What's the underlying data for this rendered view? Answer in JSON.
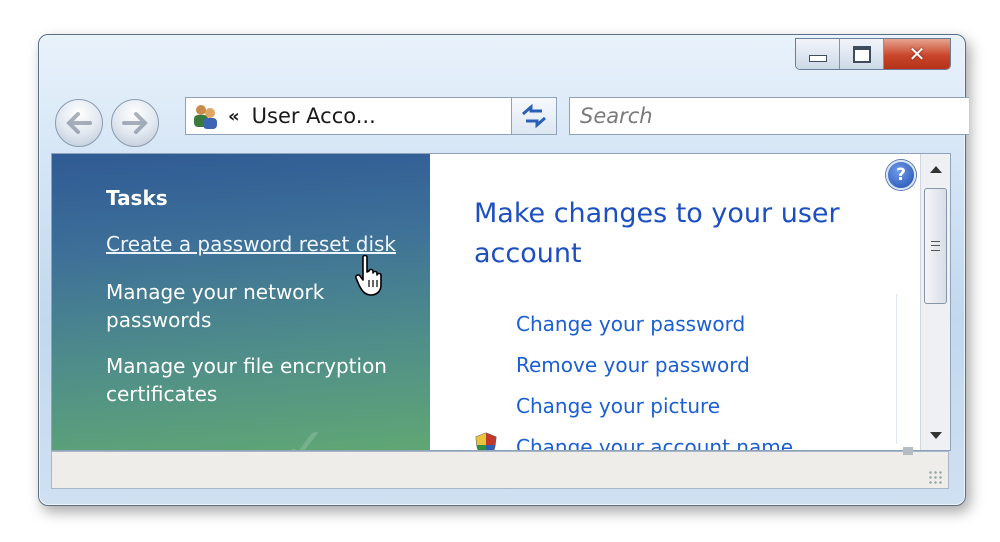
{
  "window": {
    "caption": {
      "minimize": "minimize",
      "maximize": "maximize",
      "close": "close"
    }
  },
  "nav": {
    "address_chevron": "«",
    "address_text": "User Acco...",
    "search_placeholder": "Search"
  },
  "left_pane": {
    "title": "Tasks",
    "tasks": [
      {
        "label": "Create a password reset disk"
      },
      {
        "label": "Manage your network passwords"
      },
      {
        "label": "Manage your file encryption certificates"
      }
    ]
  },
  "right_pane": {
    "heading": "Make changes to your user account",
    "links": [
      {
        "label": "Change your password"
      },
      {
        "label": "Remove your password"
      },
      {
        "label": "Change your picture"
      },
      {
        "label": "Change your account name"
      }
    ],
    "help_glyph": "?"
  },
  "icons": {
    "back": "arrow-left-icon",
    "forward": "arrow-right-icon",
    "users": "users-icon",
    "refresh": "refresh-icon",
    "help": "help-icon",
    "shield": "uac-shield-icon",
    "cursor": "hand-cursor-icon"
  },
  "colors": {
    "link": "#1a5fd3",
    "heading": "#1c4fbf",
    "close_button": "#c9462b",
    "task_pane_top": "#2f5a94",
    "task_pane_bottom": "#5fa774"
  }
}
